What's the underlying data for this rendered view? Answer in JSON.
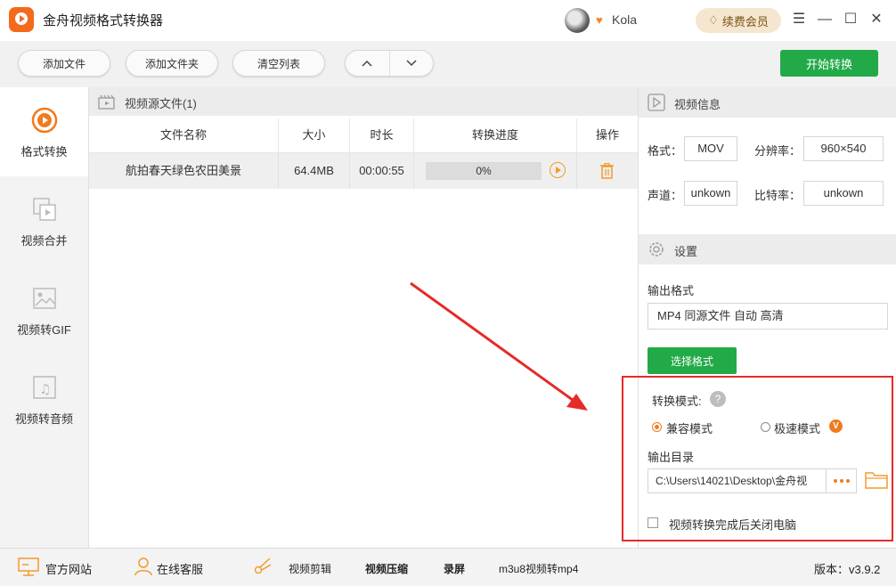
{
  "app": {
    "title": "金舟视频格式转换器",
    "username": "Kola",
    "renew_label": "续费会员"
  },
  "toolbar": {
    "add_file": "添加文件",
    "add_folder": "添加文件夹",
    "clear_list": "清空列表",
    "start": "开始转换"
  },
  "sidebar": {
    "items": [
      {
        "label": "格式转换",
        "icon": "format-convert-icon",
        "active": true
      },
      {
        "label": "视频合并",
        "icon": "video-merge-icon",
        "active": false
      },
      {
        "label": "视频转GIF",
        "icon": "video-to-gif-icon",
        "active": false
      },
      {
        "label": "视频转音频",
        "icon": "video-to-audio-icon",
        "active": false
      }
    ]
  },
  "filelist": {
    "header": "视频源文件(1)",
    "columns": [
      "文件名称",
      "大小",
      "时长",
      "转换进度",
      "操作"
    ],
    "rows": [
      {
        "name": "航拍春天绿色农田美景",
        "size": "64.4MB",
        "duration": "00:00:55",
        "progress": "0%"
      }
    ]
  },
  "video_info": {
    "title": "视频信息",
    "format_label": "格式：",
    "format": "MOV",
    "resolution_label": "分辨率：",
    "resolution": "960×540",
    "channel_label": "声道：",
    "channel": "unkown",
    "bitrate_label": "比特率：",
    "bitrate": "unkown"
  },
  "settings": {
    "title": "设置",
    "output_format_label": "输出格式",
    "output_format": "MP4 同源文件 自动 高清",
    "choose_format": "选择格式",
    "mode_label": "转换模式:",
    "mode_compatible": "兼容模式",
    "mode_fast": "极速模式",
    "output_dir_label": "输出目录",
    "output_dir": "C:\\Users\\14021\\Desktop\\金舟视",
    "shutdown_label": "视频转换完成后关闭电脑"
  },
  "bottom": {
    "official_site": "官方网站",
    "online_service": "在线客服",
    "video_edit": "视频剪辑",
    "video_compress": "视频压缩",
    "screen_record": "录屏",
    "m3u8": "m3u8视频转mp4",
    "version": "版本：v3.9.2"
  },
  "colors": {
    "accent_orange": "#f07b1e",
    "green": "#22aa48",
    "highlight_red": "#e52a2a"
  }
}
